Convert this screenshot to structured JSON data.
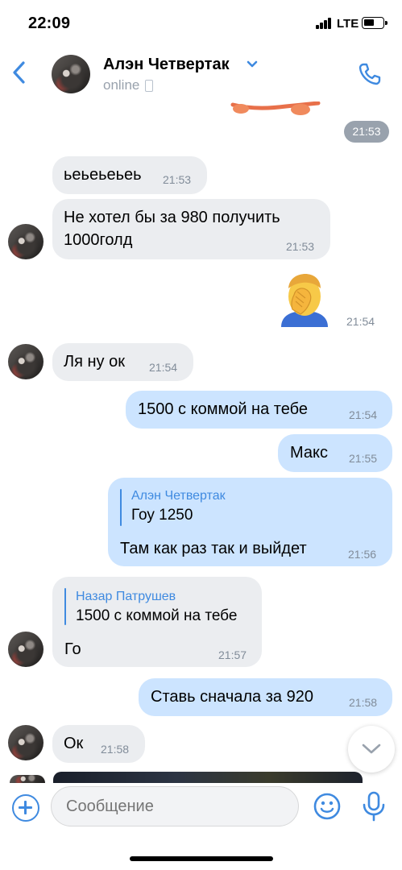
{
  "status_bar": {
    "time": "22:09",
    "network": "LTE",
    "battery_level": 0.45
  },
  "header": {
    "title": "Алэн Четвертак",
    "subtitle": "online"
  },
  "messages": {
    "top_time": "21:53",
    "m1": {
      "text": "ьеьеьеьеь",
      "time": "21:53"
    },
    "m2": {
      "line1": "Не хотел бы за 980 получить",
      "line2": "1000голд",
      "time": "21:53"
    },
    "m3": {
      "emoji": "facepalm",
      "time": "21:54"
    },
    "m4": {
      "text": "Ля ну ок",
      "time": "21:54"
    },
    "m5": {
      "text": "1500 с коммой на тебе",
      "time": "21:54"
    },
    "m6": {
      "text": "Макс",
      "time": "21:55"
    },
    "m7": {
      "reply_name": "Алэн Четвертак",
      "reply_text": "Гоу 1250",
      "text": "Там как раз так и выйдет",
      "time": "21:56"
    },
    "m8": {
      "reply_name": "Назар Патрушев",
      "reply_text": "1500 с коммой на тебе",
      "text": "Го",
      "time": "21:57"
    },
    "m9": {
      "text": "Ставь сначала за 920",
      "time": "21:58"
    },
    "m10": {
      "text": "Ок",
      "time": "21:58"
    }
  },
  "composer": {
    "placeholder": "Сообщение"
  },
  "colors": {
    "accent": "#3f8ae0",
    "incoming": "#ebedf0",
    "outgoing": "#cce4ff",
    "secondary": "#818c99"
  },
  "icons": [
    "back-icon",
    "chevron-down-icon",
    "phone-icon",
    "attach-icon",
    "smile-icon",
    "mic-icon",
    "scroll-down-icon"
  ]
}
